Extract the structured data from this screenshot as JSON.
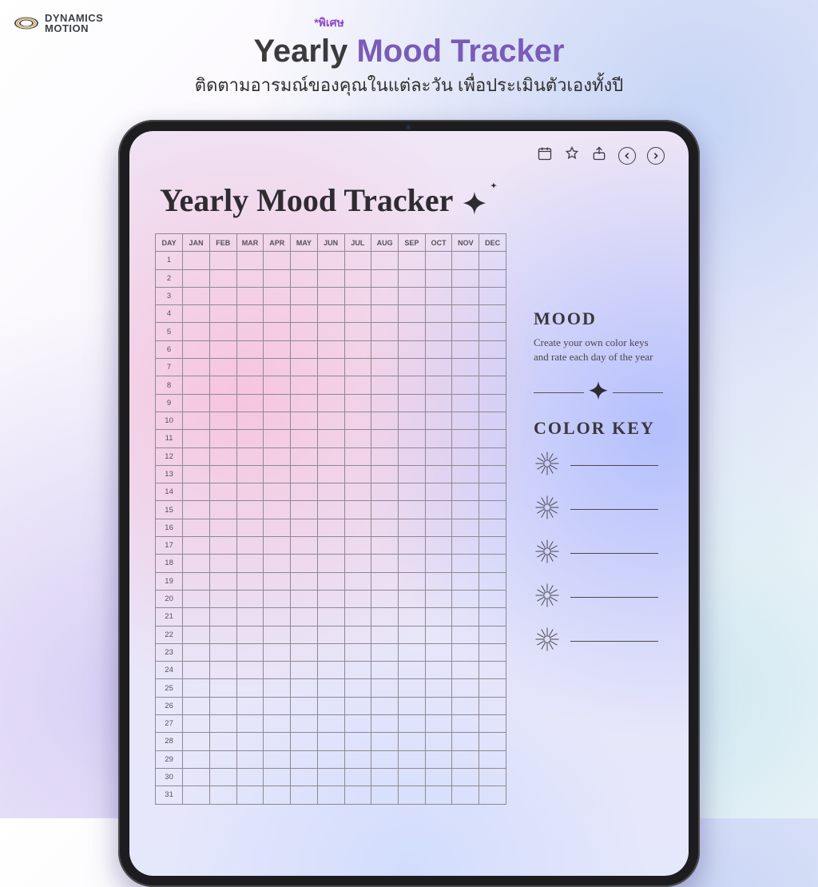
{
  "brand": {
    "line1": "DYNAMICS",
    "line2": "MOTION"
  },
  "headline": {
    "tag": "*พิเศษ",
    "title_plain": "Yearly",
    "title_accent": "Mood Tracker",
    "subtitle": "ติดตามอารมณ์ของคุณในแต่ละวัน เพื่อประเมินตัวเองทั้งปี"
  },
  "toolbar": {
    "calendar": "calendar",
    "star": "star",
    "share": "share",
    "prev": "previous",
    "next": "next"
  },
  "page": {
    "title": "Yearly Mood Tracker"
  },
  "table": {
    "corner": "DAY",
    "months": [
      "JAN",
      "FEB",
      "MAR",
      "APR",
      "MAY",
      "JUN",
      "JUL",
      "AUG",
      "SEP",
      "OCT",
      "NOV",
      "DEC"
    ],
    "days": [
      "1",
      "2",
      "3",
      "4",
      "5",
      "6",
      "7",
      "8",
      "9",
      "10",
      "11",
      "12",
      "13",
      "14",
      "15",
      "16",
      "17",
      "18",
      "19",
      "20",
      "21",
      "22",
      "23",
      "24",
      "25",
      "26",
      "27",
      "28",
      "29",
      "30",
      "31"
    ]
  },
  "side": {
    "mood_heading": "MOOD",
    "mood_text": "Create your own color keys and rate each day of the year",
    "colorkey_heading": "COLOR KEY",
    "keys": [
      "",
      "",
      "",
      "",
      ""
    ]
  }
}
